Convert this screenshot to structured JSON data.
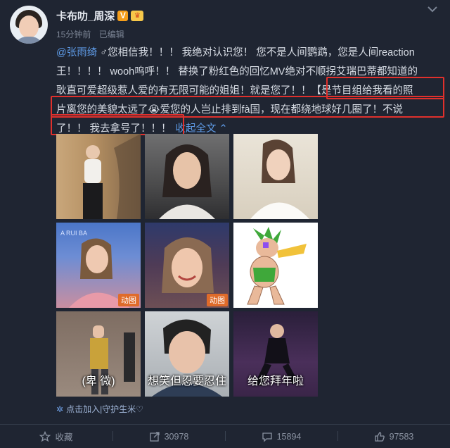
{
  "user": {
    "name": "卡布叻_周深",
    "verified_badge": "V",
    "time": "15分钟前",
    "edited": "已编辑"
  },
  "post": {
    "mention": "@张雨绮",
    "line1_text": " ♂您相信我！！！ 我绝对认识您！ 您不是人间鹦鹉，您是人间reaction",
    "line2": "王！！！！ wooh呜呼！！ 替换了粉红色的回忆MV绝对不顺拐艾瑞巴蒂都知道的",
    "line3": "耿直可爱超级惹人爱的有无限可能的姐姐！就是您了！！【是节目组给我看的照",
    "line4": "片离您的美貌太远了😭爱您的人岂止排到fà国，现在都绕地球好几圈了！不说",
    "line5_text": "了！！ 我去拿号了！！！",
    "collapse_label": "收起全文 ⌃"
  },
  "images": [
    {
      "name": "photo-1"
    },
    {
      "name": "photo-2"
    },
    {
      "name": "photo-3"
    },
    {
      "name": "photo-4",
      "tag": "动图"
    },
    {
      "name": "photo-5",
      "tag": "动图"
    },
    {
      "name": "photo-6"
    },
    {
      "name": "photo-7",
      "caption": "(卑 微)"
    },
    {
      "name": "photo-8",
      "caption": "想笑但忍要忍住"
    },
    {
      "name": "photo-9",
      "caption": "给您拜年啦"
    }
  ],
  "fan_link": "点击加入|守护生米♡",
  "actions": {
    "favorite": "收藏",
    "repost": "30978",
    "comment": "15894",
    "like": "97583"
  },
  "colors": {
    "background": "#1f2532",
    "link": "#5f9ce8",
    "highlight_box": "#e0302c"
  }
}
